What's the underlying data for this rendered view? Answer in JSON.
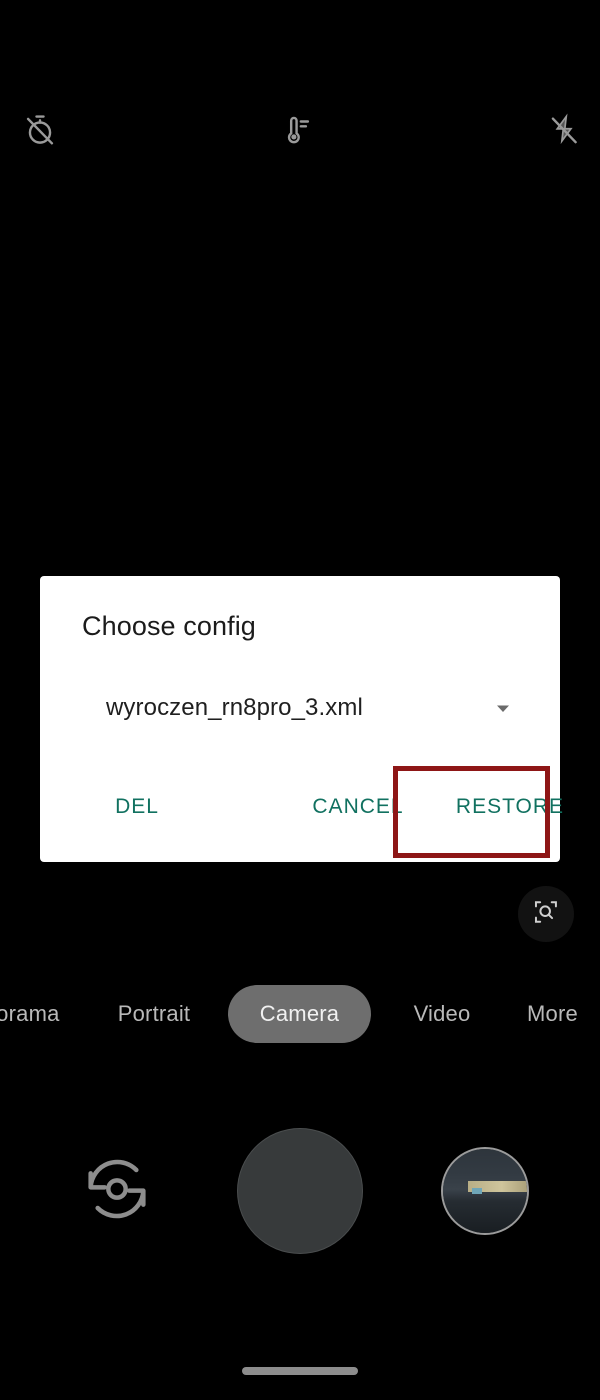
{
  "app": {
    "name": "Camera",
    "background_color": "#000000"
  },
  "topbar": {
    "controls": [
      {
        "name": "timer-off-icon",
        "label": "Timer off"
      },
      {
        "name": "white-balance-icon",
        "label": "White balance"
      },
      {
        "name": "flash-off-icon",
        "label": "Flash off"
      }
    ]
  },
  "dialog": {
    "title": "Choose config",
    "spinner": {
      "selected_value": "wyroczen_rn8pro_3.xml",
      "arrow_icon": "chevron-down-icon"
    },
    "buttons": {
      "delete_label": "DEL",
      "cancel_label": "CANCEL",
      "restore_label": "RESTORE"
    },
    "accent_color": "#117160",
    "surface_color": "#ffffff"
  },
  "annotation": {
    "target": "RESTORE",
    "box_color": "#8e1616"
  },
  "lens_chip": {
    "icon": "zoom-lens-icon"
  },
  "modes": {
    "items": [
      {
        "label": "Panorama",
        "selected": false
      },
      {
        "label": "Portrait",
        "selected": false
      },
      {
        "label": "Camera",
        "selected": true
      },
      {
        "label": "Video",
        "selected": false
      },
      {
        "label": "More",
        "selected": false
      }
    ],
    "selected_label": "Camera",
    "selected_pill_color": "#6e6e6e"
  },
  "capture_bar": {
    "flip_icon": "camera-flip-icon",
    "shutter_label": "Shutter",
    "shutter_color": "#373a3b",
    "thumbnail_label": "Last photo"
  },
  "system": {
    "home_indicator_color": "#8d8d8d"
  }
}
